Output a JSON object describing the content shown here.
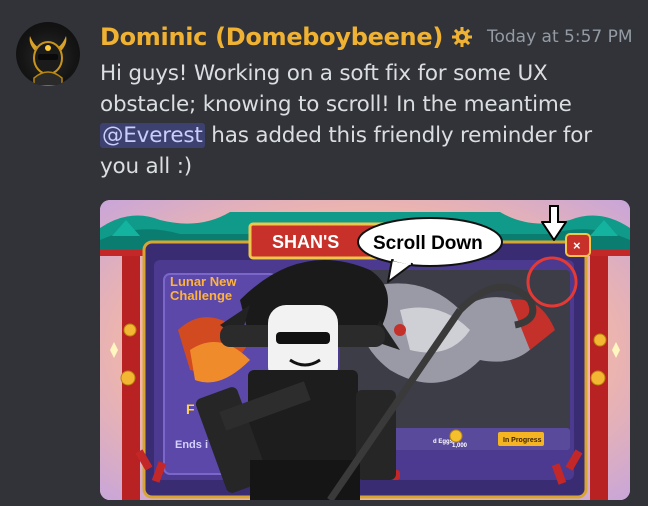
{
  "author": {
    "name": "Dominic (Domeboybeene)",
    "name_color": "#f0b232",
    "role_icon": "gear-badge-icon",
    "avatar": "horned-helmet-avatar"
  },
  "timestamp": "Today at 5:57 PM",
  "message": {
    "text_before": "Hi guys! Working on a soft fix for some UX obstacle; knowing to scroll! In the meantime ",
    "mention": "@Everest",
    "text_after": " has added this friendly reminder for you all :)"
  },
  "attachment": {
    "banner_title": "SHAN'S",
    "speech_bubble": "Scroll Down",
    "panel_title_line1": "Lunar New",
    "panel_title_line2": "Challenge",
    "ends_label": "Ends i",
    "eggs_label": "d Eggs.",
    "coin_amount": "1,000",
    "status_button": "In Progress",
    "close_label": "×",
    "letter_f": "F"
  },
  "colors": {
    "background": "#313338",
    "text": "#dbdee1",
    "timestamp": "#949ba4",
    "mention_bg": "#3c4270",
    "mention_text": "#c9cdfb",
    "highlight_circle": "#e53935"
  }
}
